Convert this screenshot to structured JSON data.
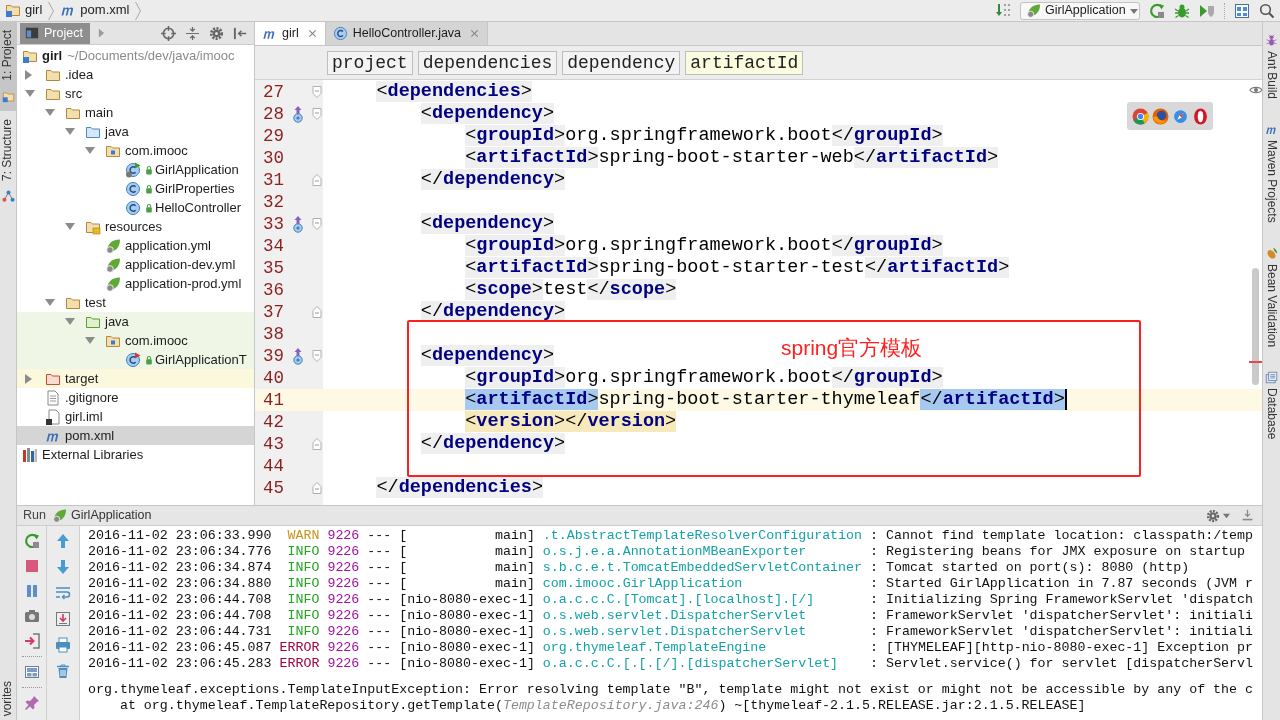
{
  "navbar": {
    "breadcrumbs": [
      {
        "label": "girl",
        "kind": "module"
      },
      {
        "label": "pom.xml",
        "kind": "maven"
      }
    ],
    "run_config": "GirlApplication"
  },
  "left_strip": {
    "top": [
      {
        "label": "1: Project",
        "kind": "project",
        "selected": true
      },
      {
        "label": "7: Structure",
        "kind": "structure",
        "selected": false
      }
    ],
    "bottom": [
      {
        "label": "vorites",
        "selected": false
      }
    ]
  },
  "project_panel": {
    "title": "Project",
    "tree": [
      {
        "label": "girl",
        "path": "~/Documents/dev/java/imooc",
        "kind": "module",
        "selected": false,
        "children": [
          {
            "label": ".idea",
            "kind": "folder",
            "expanded": false,
            "selected": false
          },
          {
            "label": "src",
            "kind": "folder",
            "expanded": true,
            "selected": false,
            "children": [
              {
                "label": "main",
                "kind": "folder",
                "expanded": true,
                "selected": false,
                "children": [
                  {
                    "label": "java",
                    "kind": "source",
                    "expanded": true,
                    "selected": false,
                    "children": [
                      {
                        "label": "com.imooc",
                        "kind": "package",
                        "expanded": true,
                        "selected": false,
                        "children": [
                          {
                            "label": "GirlApplication",
                            "kind": "app-class",
                            "selected": false
                          },
                          {
                            "label": "GirlProperties",
                            "kind": "class",
                            "selected": false
                          },
                          {
                            "label": "HelloController",
                            "kind": "class",
                            "selected": false
                          }
                        ]
                      }
                    ]
                  },
                  {
                    "label": "resources",
                    "kind": "resources",
                    "expanded": true,
                    "selected": false,
                    "children": [
                      {
                        "label": "application.yml",
                        "kind": "yml",
                        "selected": false
                      },
                      {
                        "label": "application-dev.yml",
                        "kind": "yml",
                        "selected": false
                      },
                      {
                        "label": "application-prod.yml",
                        "kind": "yml",
                        "selected": false
                      }
                    ]
                  }
                ]
              },
              {
                "label": "test",
                "kind": "folder",
                "expanded": true,
                "selected": false,
                "children": [
                  {
                    "label": "java",
                    "kind": "test-source",
                    "expanded": true,
                    "selected": false,
                    "children": [
                      {
                        "label": "com.imooc",
                        "kind": "package",
                        "expanded": true,
                        "selected": false,
                        "children": [
                          {
                            "label": "GirlApplicationT",
                            "kind": "test-class",
                            "selected": false
                          }
                        ]
                      }
                    ]
                  }
                ]
              }
            ]
          },
          {
            "label": "target",
            "kind": "excluded",
            "expanded": false,
            "selected": false
          },
          {
            "label": ".gitignore",
            "kind": "file",
            "selected": false
          },
          {
            "label": "girl.iml",
            "kind": "iml",
            "selected": false
          },
          {
            "label": "pom.xml",
            "kind": "maven",
            "selected": true
          }
        ]
      },
      {
        "label": "External Libraries",
        "kind": "libraries",
        "selected": false
      }
    ]
  },
  "editor": {
    "tabs": [
      {
        "label": "girl",
        "kind": "maven",
        "selected": true
      },
      {
        "label": "HelloController.java",
        "kind": "class",
        "selected": false
      }
    ],
    "breadcrumbs": [
      {
        "label": "project",
        "selected": false
      },
      {
        "label": "dependencies",
        "selected": false
      },
      {
        "label": "dependency",
        "selected": false
      },
      {
        "label": "artifactId",
        "selected": true
      }
    ],
    "lines": [
      {
        "number": "27",
        "marker": false,
        "fold_start": true,
        "fold_end": false,
        "current": false,
        "warning": false,
        "caret": false,
        "code": [
          {
            "kind": "tag",
            "text": "    <dependencies>"
          }
        ]
      },
      {
        "number": "28",
        "marker": true,
        "fold_start": true,
        "fold_end": false,
        "current": false,
        "warning": false,
        "caret": false,
        "code": [
          {
            "kind": "tag",
            "text": "        <dependency>"
          }
        ]
      },
      {
        "number": "29",
        "marker": false,
        "fold_start": false,
        "fold_end": false,
        "current": false,
        "warning": false,
        "caret": false,
        "code": [
          {
            "kind": "tag",
            "text": "            <groupId>"
          },
          {
            "kind": "text",
            "text": "org.springframework.boot"
          },
          {
            "kind": "tag",
            "text": "</groupId>"
          }
        ]
      },
      {
        "number": "30",
        "marker": false,
        "fold_start": false,
        "fold_end": false,
        "current": false,
        "warning": false,
        "caret": false,
        "code": [
          {
            "kind": "tag",
            "text": "            <artifactId>"
          },
          {
            "kind": "text",
            "text": "spring-boot-starter-web"
          },
          {
            "kind": "tag",
            "text": "</artifactId>"
          }
        ]
      },
      {
        "number": "31",
        "marker": false,
        "fold_start": false,
        "fold_end": true,
        "current": false,
        "warning": false,
        "caret": false,
        "code": [
          {
            "kind": "tag",
            "text": "        </dependency>"
          }
        ]
      },
      {
        "number": "32",
        "marker": false,
        "fold_start": false,
        "fold_end": false,
        "current": false,
        "warning": false,
        "caret": false
      },
      {
        "number": "33",
        "marker": true,
        "fold_start": true,
        "fold_end": false,
        "current": false,
        "warning": false,
        "caret": false,
        "code": [
          {
            "kind": "tag",
            "text": "        <dependency>"
          }
        ]
      },
      {
        "number": "34",
        "marker": false,
        "fold_start": false,
        "fold_end": false,
        "current": false,
        "warning": false,
        "caret": false,
        "code": [
          {
            "kind": "tag",
            "text": "            <groupId>"
          },
          {
            "kind": "text",
            "text": "org.springframework.boot"
          },
          {
            "kind": "tag",
            "text": "</groupId>"
          }
        ]
      },
      {
        "number": "35",
        "marker": false,
        "fold_start": false,
        "fold_end": false,
        "current": false,
        "warning": false,
        "caret": false,
        "code": [
          {
            "kind": "tag",
            "text": "            <artifactId>"
          },
          {
            "kind": "text",
            "text": "spring-boot-starter-test"
          },
          {
            "kind": "tag",
            "text": "</artifactId>"
          }
        ]
      },
      {
        "number": "36",
        "marker": false,
        "fold_start": false,
        "fold_end": false,
        "current": false,
        "warning": false,
        "caret": false,
        "code": [
          {
            "kind": "tag",
            "text": "            <scope>"
          },
          {
            "kind": "text",
            "text": "test"
          },
          {
            "kind": "tag",
            "text": "</scope>"
          }
        ]
      },
      {
        "number": "37",
        "marker": false,
        "fold_start": false,
        "fold_end": true,
        "current": false,
        "warning": false,
        "caret": false,
        "code": [
          {
            "kind": "tag",
            "text": "        </dependency>"
          }
        ]
      },
      {
        "number": "38",
        "marker": false,
        "fold_start": false,
        "fold_end": false,
        "current": false,
        "warning": false,
        "caret": false
      },
      {
        "number": "39",
        "marker": true,
        "fold_start": true,
        "fold_end": false,
        "current": false,
        "warning": false,
        "caret": false,
        "code": [
          {
            "kind": "tag",
            "text": "        <dependency>"
          }
        ]
      },
      {
        "number": "40",
        "marker": false,
        "fold_start": false,
        "fold_end": false,
        "current": false,
        "warning": false,
        "caret": false,
        "code": [
          {
            "kind": "tag",
            "text": "            <groupId>"
          },
          {
            "kind": "text",
            "text": "org.springframework.boot"
          },
          {
            "kind": "tag",
            "text": "</groupId>"
          }
        ]
      },
      {
        "number": "41",
        "marker": false,
        "fold_start": false,
        "fold_end": false,
        "current": true,
        "warning": false,
        "caret": true,
        "code": [
          {
            "kind": "tag",
            "text": "            <artifactId>",
            "selected": true
          },
          {
            "kind": "text",
            "text": "spring-boot-starter-thymeleaf",
            "selected": false
          },
          {
            "kind": "tag",
            "text": "</artifactId>",
            "selected": true
          }
        ]
      },
      {
        "number": "42",
        "marker": false,
        "fold_start": false,
        "fold_end": false,
        "current": false,
        "warning": true,
        "caret": false,
        "code": [
          {
            "kind": "tag",
            "text": "            <version>"
          },
          {
            "kind": "tag",
            "text": "</version>"
          }
        ]
      },
      {
        "number": "43",
        "marker": false,
        "fold_start": false,
        "fold_end": true,
        "current": false,
        "warning": false,
        "caret": false,
        "code": [
          {
            "kind": "tag",
            "text": "        </dependency>"
          }
        ]
      },
      {
        "number": "44",
        "marker": false,
        "fold_start": false,
        "fold_end": false,
        "current": false,
        "warning": false,
        "caret": false
      },
      {
        "number": "45",
        "marker": false,
        "fold_start": false,
        "fold_end": true,
        "current": false,
        "warning": false,
        "caret": false,
        "code": [
          {
            "kind": "tag",
            "text": "    </dependencies>"
          }
        ]
      }
    ],
    "annotation": {
      "text": "spring官方模板"
    }
  },
  "right_strip": [
    {
      "label": "Ant Build",
      "kind": "ant"
    },
    {
      "label": "Maven Projects",
      "kind": "maven"
    },
    {
      "label": "Bean Validation",
      "kind": "bean"
    },
    {
      "label": "Database",
      "kind": "database"
    }
  ],
  "run_panel": {
    "title": "Run",
    "config": "GirlApplication",
    "log": [
      {
        "time": "2016-11-02 23:06:33.990",
        "level": "WARN",
        "pid": "9226",
        "separator": "---",
        "thread": "[           main]",
        "logger": ".t.AbstractTemplateResolverConfiguration",
        "message": ": Cannot find template location: classpath:/temp"
      },
      {
        "time": "2016-11-02 23:06:34.776",
        "level": "INFO",
        "pid": "9226",
        "separator": "---",
        "thread": "[           main]",
        "logger": "o.s.j.e.a.AnnotationMBeanExporter",
        "message": ": Registering beans for JMX exposure on startup"
      },
      {
        "time": "2016-11-02 23:06:34.874",
        "level": "INFO",
        "pid": "9226",
        "separator": "---",
        "thread": "[           main]",
        "logger": "s.b.c.e.t.TomcatEmbeddedServletContainer",
        "message": ": Tomcat started on port(s): 8080 (http)"
      },
      {
        "time": "2016-11-02 23:06:34.880",
        "level": "INFO",
        "pid": "9226",
        "separator": "---",
        "thread": "[           main]",
        "logger": "com.imooc.GirlApplication",
        "message": ": Started GirlApplication in 7.87 seconds (JVM r"
      },
      {
        "time": "2016-11-02 23:06:44.708",
        "level": "INFO",
        "pid": "9226",
        "separator": "---",
        "thread": "[nio-8080-exec-1]",
        "logger": "o.a.c.c.C.[Tomcat].[localhost].[/]",
        "message": ": Initializing Spring FrameworkServlet 'dispatch"
      },
      {
        "time": "2016-11-02 23:06:44.708",
        "level": "INFO",
        "pid": "9226",
        "separator": "---",
        "thread": "[nio-8080-exec-1]",
        "logger": "o.s.web.servlet.DispatcherServlet",
        "message": ": FrameworkServlet 'dispatcherServlet': initiali"
      },
      {
        "time": "2016-11-02 23:06:44.731",
        "level": "INFO",
        "pid": "9226",
        "separator": "---",
        "thread": "[nio-8080-exec-1]",
        "logger": "o.s.web.servlet.DispatcherServlet",
        "message": ": FrameworkServlet 'dispatcherServlet': initiali"
      },
      {
        "time": "2016-11-02 23:06:45.087",
        "level": "ERROR",
        "pid": "9226",
        "separator": "---",
        "thread": "[nio-8080-exec-1]",
        "logger": "org.thymeleaf.TemplateEngine",
        "message": ": [THYMELEAF][http-nio-8080-exec-1] Exception pr"
      },
      {
        "time": "2016-11-02 23:06:45.283",
        "level": "ERROR",
        "pid": "9226",
        "separator": "---",
        "thread": "[nio-8080-exec-1]",
        "logger": "o.a.c.c.C.[.[.[/].[dispatcherServlet]",
        "message": ": Servlet.service() for servlet [dispatcherServl"
      }
    ],
    "exception": "org.thymeleaf.exceptions.TemplateInputException: Error resolving template \"B\", template might not exist or might not be accessible by any of the c",
    "stack": [
      "at org.thymeleaf.TemplateRepository.getTemplate(*TemplateRepository.java:246*) ~[thymeleaf-2.1.5.RELEASE.jar:2.1.5.RELEASE]"
    ]
  }
}
